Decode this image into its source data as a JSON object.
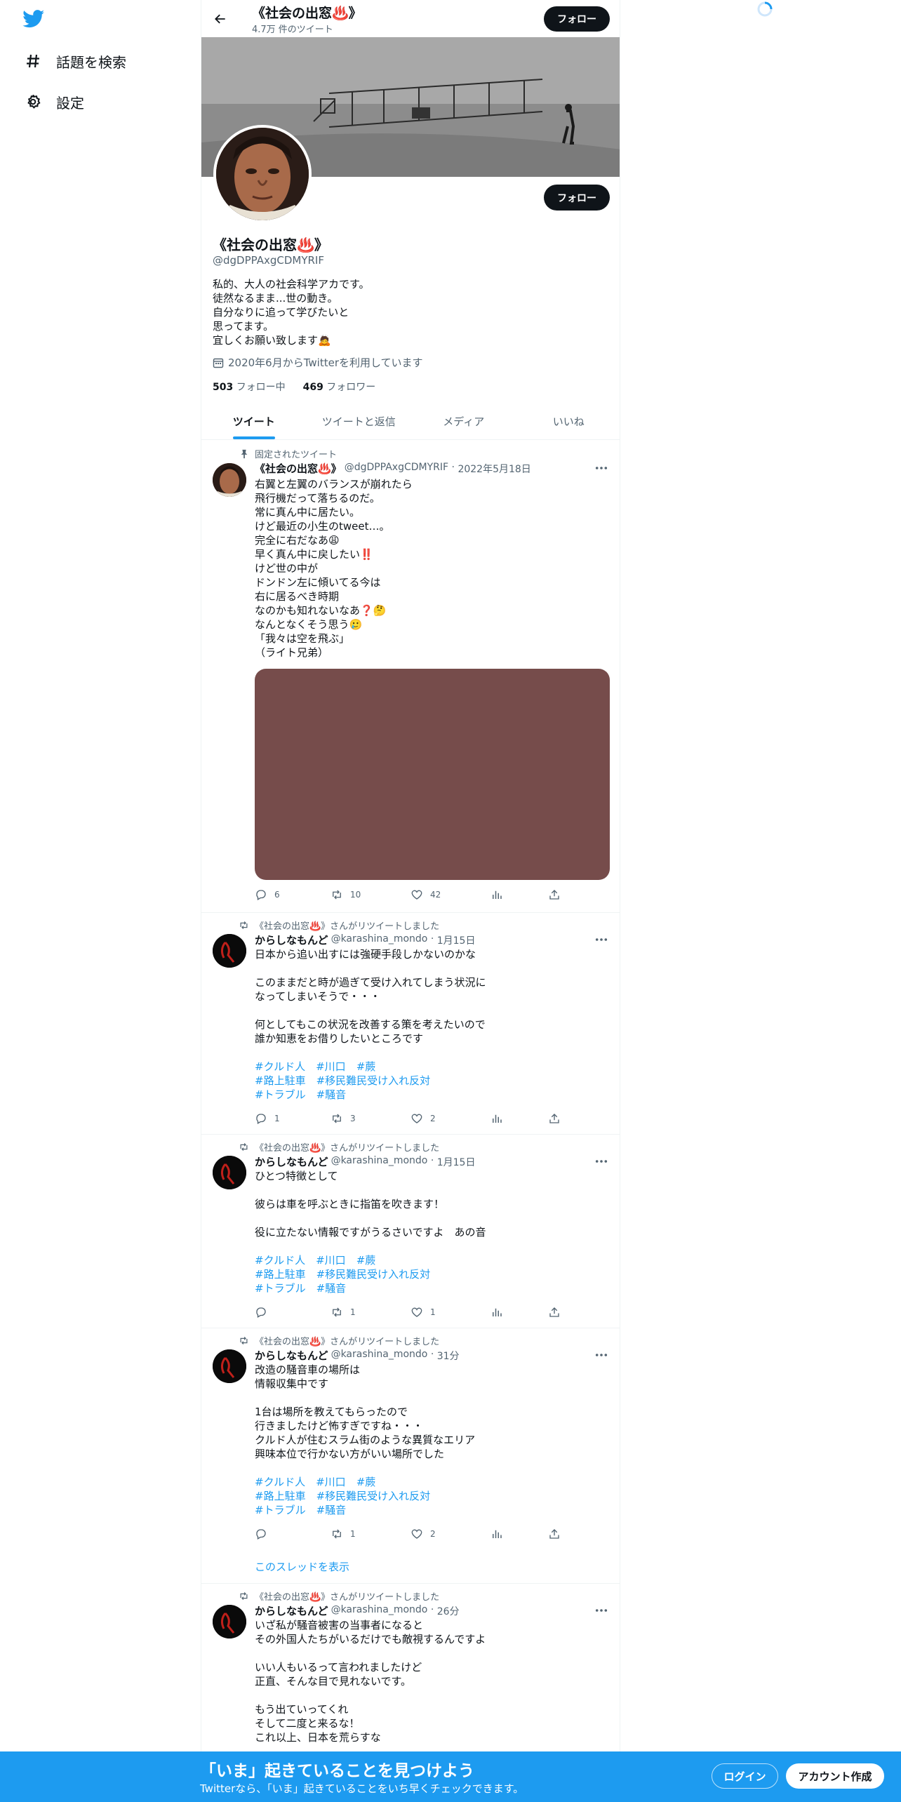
{
  "nav": {
    "explore": "話題を検索",
    "settings": "設定"
  },
  "header": {
    "name": "《社会の出窓♨️》",
    "tweet_count": "4.7万 件のツイート",
    "follow": "フォロー"
  },
  "profile": {
    "name": "《社会の出窓♨️》",
    "handle": "@dgDPPAxgCDMYRIF",
    "bio": "私的、大人の社会科学アカです。\n徒然なるまま...世の動き。\n自分なりに追って学びたいと\n思ってます。\n宜しくお願い致します🙇",
    "joined": "2020年6月からTwitterを利用しています",
    "following_count": "503",
    "following_label": "フォロー中",
    "followers_count": "469",
    "followers_label": "フォロワー",
    "follow": "フォロー"
  },
  "tabs": [
    "ツイート",
    "ツイートと返信",
    "メディア",
    "いいね"
  ],
  "tweets": [
    {
      "context": "固定されたツイート",
      "name": "《社会の出窓♨️》",
      "handle": "@dgDPPAxgCDMYRIF",
      "time": "2022年5月18日",
      "text": "右翼と左翼のバランスが崩れたら\n飛行機だって落ちるのだ。\n常に真ん中に居たい。\nけど最近の小生のtweet…。\n完全に右だなあ😩\n早く真ん中に戻したい‼️\nけど世の中が\nドンドン左に傾いてる今は\n右に居るべき時期\nなのかも知れないなあ❓🤔\nなんとなくそう思う🥲\n「我々は空を飛ぶ」\n（ライト兄弟）",
      "replies": "6",
      "retweets": "10",
      "likes": "42"
    },
    {
      "context": "《社会の出窓♨️》さんがリツイートしました",
      "name": "からしなもんど",
      "handle": "@karashina_mondo",
      "time": "1月15日",
      "text": "日本から追い出すには強硬手段しかないのかな\n\nこのままだと時が過ぎて受け入れてしまう状況に\nなってしまいそうで・・・\n\n何としてもこの状況を改善する策を考えたいので\n誰か知恵をお借りしたいところです",
      "tags": "#クルド人　#川口　#蕨\n#路上駐車　#移民難民受け入れ反対\n#トラブル　#騒音",
      "replies": "1",
      "retweets": "3",
      "likes": "2"
    },
    {
      "context": "《社会の出窓♨️》さんがリツイートしました",
      "name": "からしなもんど",
      "handle": "@karashina_mondo",
      "time": "1月15日",
      "text": "ひとつ特徴として\n\n彼らは車を呼ぶときに指笛を吹きます！\n\n役に立たない情報ですがうるさいですよ　あの音",
      "tags": "#クルド人　#川口　#蕨\n#路上駐車　#移民難民受け入れ反対\n#トラブル　#騒音",
      "replies": "",
      "retweets": "1",
      "likes": "1"
    },
    {
      "context": "《社会の出窓♨️》さんがリツイートしました",
      "name": "からしなもんど",
      "handle": "@karashina_mondo",
      "time": "31分",
      "text": "改造の騒音車の場所は\n情報収集中です\n\n1台は場所を教えてもらったので\n行きましたけど怖すぎですね・・・\nクルド人が住むスラム街のような異質なエリア\n興味本位で行かない方がいい場所でした",
      "tags": "#クルド人　#川口　#蕨\n#路上駐車　#移民難民受け入れ反対\n#トラブル　#騒音",
      "replies": "",
      "retweets": "1",
      "likes": "2",
      "thread": "このスレッドを表示"
    },
    {
      "context": "《社会の出窓♨️》さんがリツイートしました",
      "name": "からしなもんど",
      "handle": "@karashina_mondo",
      "time": "26分",
      "text": "いざ私が騒音被害の当事者になると\nその外国人たちがいるだけでも敵視するんですよ\n\nいい人もいるって言われましたけど\n正直、そんな目で見れないです。\n\nもう出ていってくれ\nそして二度と来るな！\nこれ以上、日本を荒らすな"
    }
  ],
  "bottom": {
    "title": "「いま」起きていることを見つけよう",
    "subtitle": "Twitterなら、「いま」起きていることをいち早くチェックできます。",
    "login": "ログイン",
    "signup": "アカウント作成"
  },
  "colors": {
    "accent": "#1d9bf0",
    "dark": "#0f1419",
    "muted": "#536471",
    "media_placeholder": "#764c4b"
  }
}
